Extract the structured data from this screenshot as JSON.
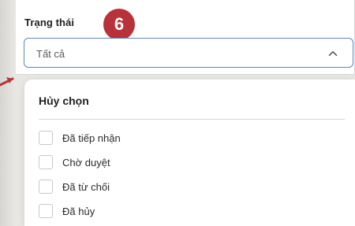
{
  "filter": {
    "label": "Trạng thái",
    "selected_value": "Tất cả",
    "step_badge": "6",
    "chevron_icon": "chevron-up-icon"
  },
  "dropdown": {
    "header": "Hủy chọn",
    "options": [
      {
        "label": "Đã tiếp nhận",
        "checked": false
      },
      {
        "label": "Chờ duyệt",
        "checked": false
      },
      {
        "label": "Đã từ chối",
        "checked": false
      },
      {
        "label": "Đã hủy",
        "checked": false
      }
    ]
  },
  "colors": {
    "badge": "#b8323a",
    "select_border": "#5b86c5",
    "arrow": "#b8323a"
  }
}
